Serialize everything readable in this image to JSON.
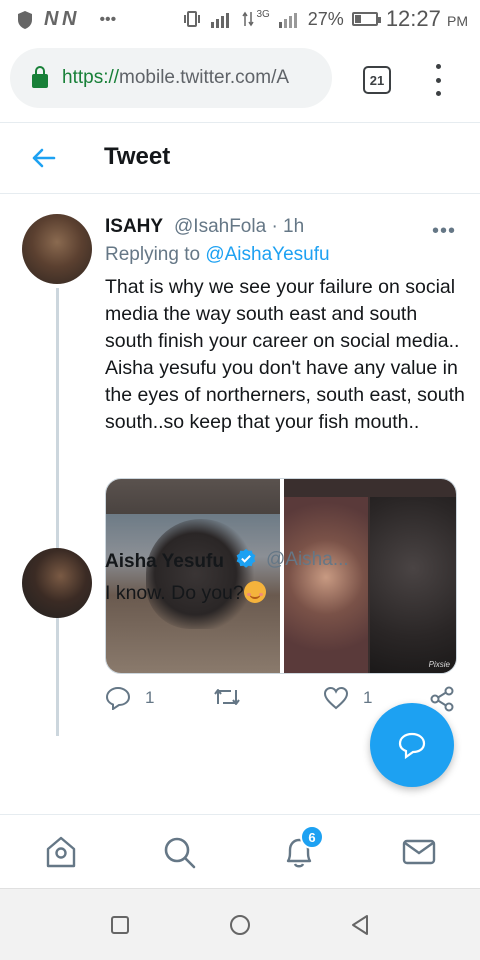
{
  "status_bar": {
    "carrier_icons": "N N",
    "dots": "•••",
    "network": "3G",
    "battery": "27%",
    "time": "12:27",
    "ampm": "PM"
  },
  "browser": {
    "url_scheme": "https://",
    "url_rest": "mobile.twitter.com/A",
    "tab_count": "21"
  },
  "header": {
    "title": "Tweet"
  },
  "tweet1": {
    "name": "ISAHY",
    "handle": "@IsahFola · 1h",
    "replying_prefix": "Replying to",
    "replying_to": "@AishaYesufu",
    "text": "That is why we see your failure on social media the way south east and south south finish your career on social media.. Aisha yesufu you don't have any value in the eyes of northerners, south east, south south..so keep that your fish mouth..",
    "reply_count": "1",
    "retweet_count": "",
    "like_count": "1",
    "watermark": "Pixsie"
  },
  "tweet2": {
    "name": "Aisha Yesufu",
    "handle": "@Aisha...",
    "text": "I know.  Do you?"
  },
  "bottom_nav": {
    "notification_badge": "6"
  },
  "colors": {
    "accent": "#1da1f2",
    "secure_green": "#188038",
    "secondary_text": "#657786"
  }
}
